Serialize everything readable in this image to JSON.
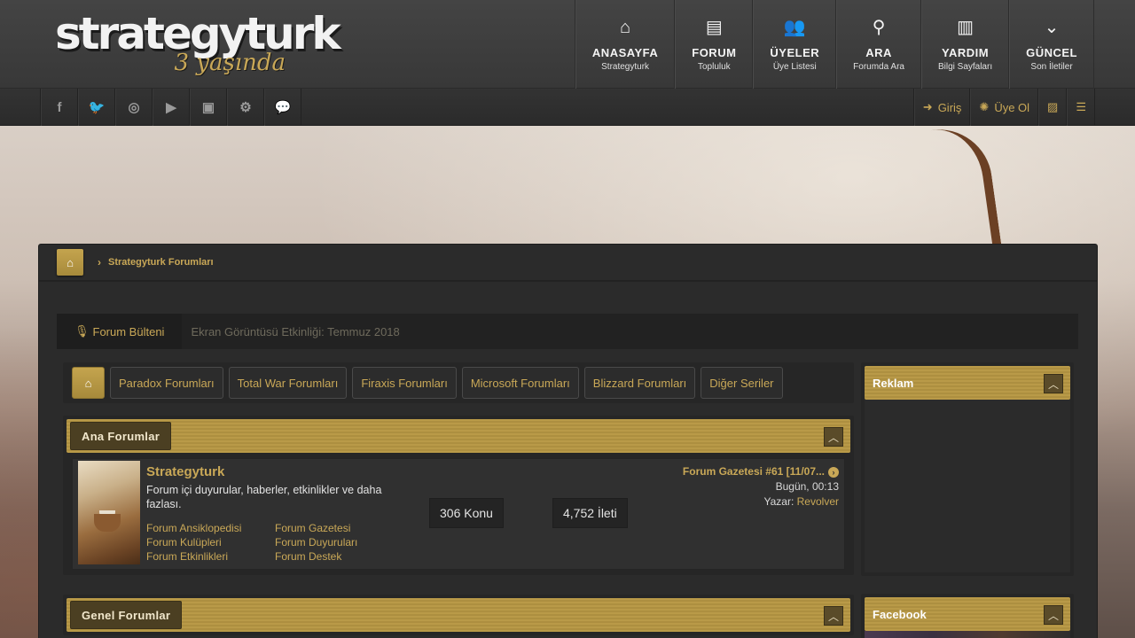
{
  "header": {
    "logo_main": "strategyturk",
    "logo_sub": "3 yaşında",
    "nav": [
      {
        "icon": "home-icon",
        "glyph": "⌂",
        "title": "ANASAYFA",
        "sub": "Strategyturk"
      },
      {
        "icon": "document-icon",
        "glyph": "▤",
        "title": "FORUM",
        "sub": "Topluluk"
      },
      {
        "icon": "users-icon",
        "glyph": "👥",
        "title": "ÜYELER",
        "sub": "Üye Listesi"
      },
      {
        "icon": "search-icon",
        "glyph": "⚲",
        "title": "ARA",
        "sub": "Forumda Ara"
      },
      {
        "icon": "book-icon",
        "glyph": "▥",
        "title": "YARDIM",
        "sub": "Bilgi Sayfaları"
      },
      {
        "icon": "chevron-down-icon",
        "glyph": "⌄",
        "title": "GÜNCEL",
        "sub": "Son İletiler"
      }
    ]
  },
  "social": [
    {
      "icon": "facebook-icon",
      "glyph": "f"
    },
    {
      "icon": "twitter-icon",
      "glyph": "🐦"
    },
    {
      "icon": "instagram-icon",
      "glyph": "◎"
    },
    {
      "icon": "youtube-icon",
      "glyph": "▶"
    },
    {
      "icon": "twitch-icon",
      "glyph": "▣"
    },
    {
      "icon": "steam-icon",
      "glyph": "⚙"
    },
    {
      "icon": "chat-icon",
      "glyph": "💬"
    }
  ],
  "userbar": {
    "login_glyph": "➜",
    "login_label": "Giriş",
    "register_glyph": "✺",
    "register_label": "Üye Ol",
    "gallery_glyph": "▨",
    "sidebar_glyph": "☰"
  },
  "breadcrumb": {
    "home_glyph": "⌂",
    "sep_glyph": "›",
    "current": "Strategyturk Forumları"
  },
  "bulletin": {
    "glyph": "🎙",
    "label": "Forum Bülteni",
    "text": "Ekran Görüntüsü Etkinliği: Temmuz 2018"
  },
  "tabs": {
    "home_glyph": "⌂",
    "items": [
      "Paradox Forumları",
      "Total War Forumları",
      "Firaxis Forumları",
      "Microsoft Forumları",
      "Blizzard Forumları",
      "Diğer Seriler"
    ]
  },
  "sections": {
    "main": {
      "title": "Ana Forumlar",
      "collapse_glyph": "︿",
      "forum": {
        "title": "Strategyturk",
        "description": "Forum içi duyurular, haberler, etkinlikler ve daha fazlası.",
        "subforums": [
          "Forum Ansiklopedisi",
          "Forum Gazetesi",
          "Forum Kulüpleri",
          "Forum Duyuruları",
          "Forum Etkinlikleri",
          "Forum Destek"
        ],
        "threads": "306 Konu",
        "posts": "4,752 İleti",
        "last_post_title": "Forum Gazetesi #61 [11/07...",
        "last_post_goto": "›",
        "last_post_date": "Bugün, 00:13",
        "last_post_author_label": "Yazar:",
        "last_post_author": "Revolver"
      }
    },
    "general": {
      "title": "Genel Forumlar",
      "collapse_glyph": "︿"
    }
  },
  "widgets": {
    "ad": {
      "title": "Reklam",
      "collapse_glyph": "︿"
    },
    "facebook": {
      "title": "Facebook",
      "collapse_glyph": "︿"
    }
  },
  "colors": {
    "accent_gold": "#c9a857",
    "header_bg": "#3e3e3e",
    "panel_bg": "#2b2b2b"
  }
}
